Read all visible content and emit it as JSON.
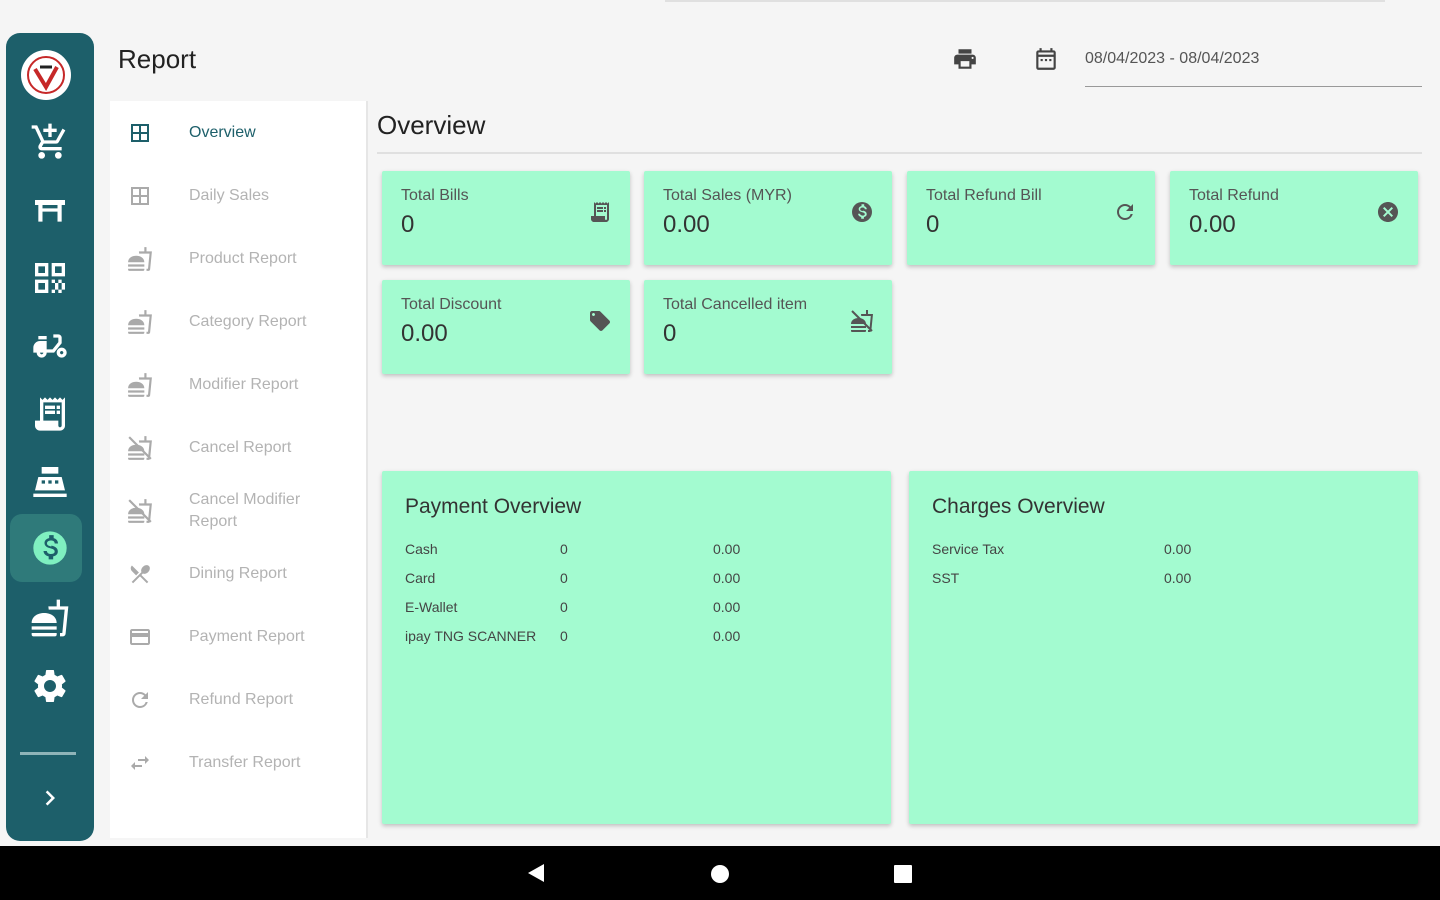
{
  "header": {
    "title": "Report",
    "print_icon": "printer-icon",
    "calendar_icon": "calendar-icon",
    "date_range": "08/04/2023 - 08/04/2023"
  },
  "rail": {
    "items": [
      {
        "name": "logo",
        "icon": "brand-logo"
      },
      {
        "name": "cart",
        "icon": "cart-add-icon"
      },
      {
        "name": "table",
        "icon": "table-icon"
      },
      {
        "name": "qr",
        "icon": "qr-code-icon"
      },
      {
        "name": "delivery",
        "icon": "scooter-icon"
      },
      {
        "name": "receipt",
        "icon": "receipt-icon"
      },
      {
        "name": "cashier",
        "icon": "cash-register-icon"
      },
      {
        "name": "report",
        "icon": "dollar-icon",
        "active": true
      },
      {
        "name": "products",
        "icon": "food-icon"
      },
      {
        "name": "settings",
        "icon": "gear-icon"
      },
      {
        "name": "expand",
        "icon": "chevron-right-icon"
      }
    ]
  },
  "submenu": {
    "items": [
      {
        "label": "Overview",
        "icon": "grid-icon",
        "active": true
      },
      {
        "label": "Daily Sales",
        "icon": "grid-icon"
      },
      {
        "label": "Product Report",
        "icon": "food-icon"
      },
      {
        "label": "Category Report",
        "icon": "food-icon"
      },
      {
        "label": "Modifier Report",
        "icon": "food-icon"
      },
      {
        "label": "Cancel Report",
        "icon": "food-off-icon"
      },
      {
        "label": "Cancel Modifier Report",
        "icon": "food-off-icon"
      },
      {
        "label": "Dining Report",
        "icon": "utensils-icon"
      },
      {
        "label": "Payment Report",
        "icon": "credit-card-icon"
      },
      {
        "label": "Refund Report",
        "icon": "refresh-icon"
      },
      {
        "label": "Transfer Report",
        "icon": "transfer-icon"
      }
    ]
  },
  "main": {
    "title": "Overview",
    "cards": [
      {
        "label": "Total Bills",
        "value": "0",
        "icon": "receipt-icon"
      },
      {
        "label": "Total Sales (MYR)",
        "value": "0.00",
        "icon": "dollar-circle-icon"
      },
      {
        "label": "Total Refund Bill",
        "value": "0",
        "icon": "refresh-icon"
      },
      {
        "label": "Total Refund",
        "value": "0.00",
        "icon": "close-circle-icon"
      },
      {
        "label": "Total Discount",
        "value": "0.00",
        "icon": "tag-icon"
      },
      {
        "label": "Total Cancelled item",
        "value": "0",
        "icon": "food-off-icon"
      }
    ],
    "payment_overview": {
      "title": "Payment Overview",
      "rows": [
        {
          "method": "Cash",
          "count": "0",
          "amount": "0.00"
        },
        {
          "method": "Card",
          "count": "0",
          "amount": "0.00"
        },
        {
          "method": "E-Wallet",
          "count": "0",
          "amount": "0.00"
        },
        {
          "method": "ipay TNG SCANNER",
          "count": "0",
          "amount": "0.00"
        }
      ]
    },
    "charges_overview": {
      "title": "Charges Overview",
      "rows": [
        {
          "name": "Service Tax",
          "amount": "0.00"
        },
        {
          "name": "SST",
          "amount": "0.00"
        }
      ]
    }
  },
  "colors": {
    "rail": "#1d5f6a",
    "card": "#a3fbd0",
    "active_text": "#1d5f6a"
  }
}
